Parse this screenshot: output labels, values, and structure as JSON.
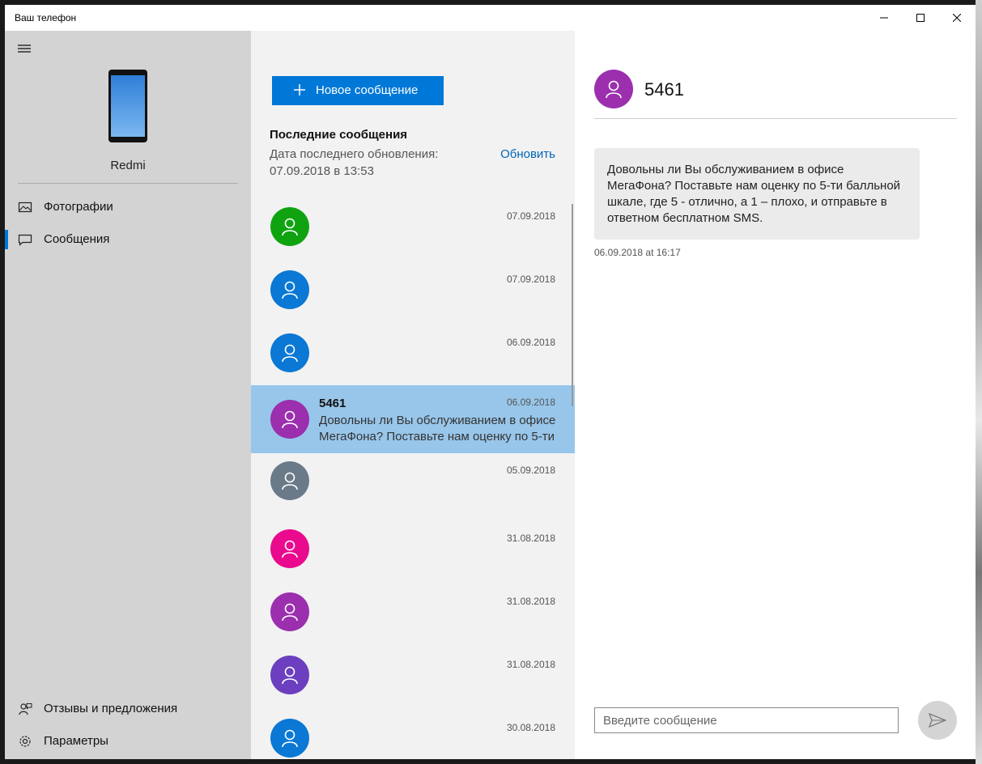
{
  "window": {
    "title": "Ваш телефон"
  },
  "sidebar": {
    "device_name": "Redmi",
    "nav": [
      {
        "label": "Фотографии",
        "icon": "photo-icon"
      },
      {
        "label": "Сообщения",
        "icon": "message-icon",
        "selected": true
      }
    ],
    "bottom": [
      {
        "label": "Отзывы и предложения",
        "icon": "feedback-icon"
      },
      {
        "label": "Параметры",
        "icon": "settings-gear-icon"
      }
    ]
  },
  "list": {
    "new_message_label": "Новое сообщение",
    "recent_title": "Последние сообщения",
    "updated_label": "Дата последнего обновления:",
    "updated_date": "07.09.2018 в 13:53",
    "refresh_label": "Обновить",
    "conversations": [
      {
        "date": "07.09.2018",
        "color": "#10a310",
        "name": "",
        "preview": ""
      },
      {
        "date": "07.09.2018",
        "color": "#0a78d4",
        "name": "",
        "preview": ""
      },
      {
        "date": "06.09.2018",
        "color": "#0a78d4",
        "name": "",
        "preview": ""
      },
      {
        "date": "06.09.2018",
        "color": "#9b2fae",
        "name": "5461",
        "preview": "Довольны ли Вы обслуживанием в офисе МегаФона? Поставьте нам оценку по 5-ти",
        "selected": true
      },
      {
        "date": "05.09.2018",
        "color": "#6b7a89",
        "name": "",
        "preview": ""
      },
      {
        "date": "31.08.2018",
        "color": "#ea0a8e",
        "name": "",
        "preview": ""
      },
      {
        "date": "31.08.2018",
        "color": "#9b2fae",
        "name": "",
        "preview": ""
      },
      {
        "date": "31.08.2018",
        "color": "#6b3fbf",
        "name": "",
        "preview": ""
      },
      {
        "date": "30.08.2018",
        "color": "#0a78d4",
        "name": "",
        "preview": ""
      }
    ]
  },
  "detail": {
    "contact_name": "5461",
    "message_text": "Довольны ли Вы обслуживанием в офисе МегаФона? Поставьте нам оценку по 5-ти балльной шкале, где 5 - отлично, а 1 – плохо, и отправьте в ответном бесплатном SMS.",
    "message_time": "06.09.2018 at 16:17",
    "input_placeholder": "Введите сообщение"
  },
  "colors": {
    "accent": "#0078d7",
    "selected_row": "#98c6ea",
    "sidebar_bg": "#d3d3d3",
    "list_bg": "#f2f2f2"
  }
}
